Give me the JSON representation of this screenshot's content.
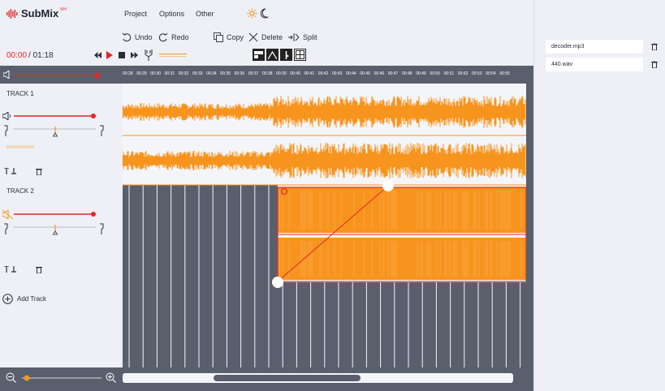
{
  "app": {
    "name": "SubMix",
    "badge": "MH"
  },
  "menu": [
    {
      "label": "Project"
    },
    {
      "label": "Options"
    },
    {
      "label": "Other"
    }
  ],
  "toolbar": {
    "undo": "Undo",
    "redo": "Redo",
    "copy": "Copy",
    "delete": "Delete",
    "split": "Split"
  },
  "transport": {
    "current": "00:00",
    "separator": " / ",
    "total": "01:18"
  },
  "ruler": [
    "00:28",
    "00:29",
    "00:30",
    "00:31",
    "00:32",
    "00:33",
    "00:34",
    "00:35",
    "00:36",
    "00:37",
    "00:38",
    "00:39",
    "00:40",
    "00:41",
    "00:42",
    "00:43",
    "00:44",
    "00:45",
    "00:46",
    "00:47",
    "00:48",
    "00:49",
    "00:50",
    "00:51",
    "00:52",
    "00:53",
    "00:54",
    "00:55"
  ],
  "tracks": [
    {
      "label": "TRACK 1"
    },
    {
      "label": "TRACK 2"
    }
  ],
  "add_track": "Add Track",
  "files": [
    {
      "name": "decoder.mp3"
    },
    {
      "name": "440.wav"
    }
  ],
  "colors": {
    "accent": "#f7941d",
    "record": "#e02828",
    "panel_dark": "#5a5f6e"
  }
}
